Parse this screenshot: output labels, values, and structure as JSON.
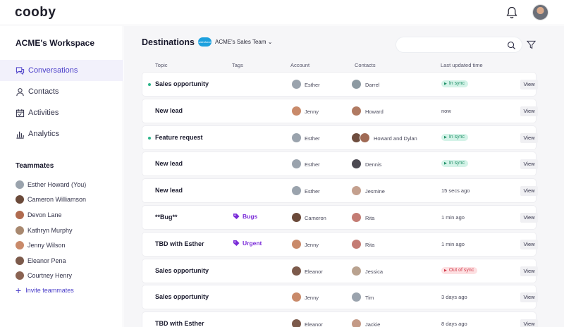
{
  "app": {
    "logo": "cooby"
  },
  "sidebar": {
    "workspace": "ACME's Workspace",
    "nav": [
      {
        "label": "Conversations",
        "icon": "chat-icon",
        "active": true
      },
      {
        "label": "Contacts",
        "icon": "person-icon"
      },
      {
        "label": "Activities",
        "icon": "calendar-icon"
      },
      {
        "label": "Analytics",
        "icon": "bar-chart-icon"
      }
    ],
    "teammates_title": "Teammates",
    "teammates": [
      {
        "name": "Esther Howard (You)",
        "color": "#9aa3ad"
      },
      {
        "name": "Cameron Williamson",
        "color": "#6b4a3a"
      },
      {
        "name": "Devon Lane",
        "color": "#b06b4f"
      },
      {
        "name": "Kathryn Murphy",
        "color": "#a8886f"
      },
      {
        "name": "Jenny Wilson",
        "color": "#c98a6a"
      },
      {
        "name": "Eleanor Pena",
        "color": "#7c5a4b"
      },
      {
        "name": "Courtney Henry",
        "color": "#8a6352"
      }
    ],
    "invite": "Invite teammates"
  },
  "main": {
    "title": "Destinations",
    "salesforce_label": "salesforce",
    "team_select": "ACME's Sales Team",
    "columns": [
      "Topic",
      "Tags",
      "Account",
      "Contacts",
      "Last updated time"
    ],
    "view_label": "View",
    "rows": [
      {
        "topic": "Sales opportunity",
        "dot": true,
        "tag": "",
        "account": "Esther",
        "account_color": "#9aa3ad",
        "contacts": "Darrel",
        "contact_colors": [
          "#8d9aa2"
        ],
        "time": "",
        "status": "In sync"
      },
      {
        "topic": "New lead",
        "dot": false,
        "tag": "",
        "account": "Jenny",
        "account_color": "#c98a6a",
        "contacts": "Howard",
        "contact_colors": [
          "#b07a62"
        ],
        "time": "now",
        "status": ""
      },
      {
        "topic": "Feature request",
        "dot": true,
        "tag": "",
        "account": "Esther",
        "account_color": "#9aa3ad",
        "contacts": "Howard and Dylan",
        "contact_colors": [
          "#6e4d3e",
          "#a06a55"
        ],
        "time": "",
        "status": "In sync"
      },
      {
        "topic": "New lead",
        "dot": false,
        "tag": "",
        "account": "Esther",
        "account_color": "#9aa3ad",
        "contacts": "Dennis",
        "contact_colors": [
          "#4c4a52"
        ],
        "time": "",
        "status": "In sync"
      },
      {
        "topic": "New lead",
        "dot": false,
        "tag": "",
        "account": "Esther",
        "account_color": "#9aa3ad",
        "contacts": "Jesmine",
        "contact_colors": [
          "#c4a08e"
        ],
        "time": "15 secs ago",
        "status": ""
      },
      {
        "topic": "**Bug**",
        "dot": false,
        "tag": "Bugs",
        "account": "Cameron",
        "account_color": "#6b4a3a",
        "contacts": "Rita",
        "contact_colors": [
          "#c47c74"
        ],
        "time": "1 min ago",
        "status": ""
      },
      {
        "topic": "TBD with Esther",
        "dot": false,
        "tag": "Urgent",
        "account": "Jenny",
        "account_color": "#c98a6a",
        "contacts": "Rita",
        "contact_colors": [
          "#c47c74"
        ],
        "time": "1 min ago",
        "status": ""
      },
      {
        "topic": "Sales opportunity",
        "dot": false,
        "tag": "",
        "account": "Eleanor",
        "account_color": "#7c5a4b",
        "contacts": "Jessica",
        "contact_colors": [
          "#b9a28f"
        ],
        "time": "",
        "status": "Out of sync"
      },
      {
        "topic": "Sales opportunity",
        "dot": false,
        "tag": "",
        "account": "Jenny",
        "account_color": "#c98a6a",
        "contacts": "Tim",
        "contact_colors": [
          "#9aa3ad"
        ],
        "time": "3 days ago",
        "status": ""
      },
      {
        "topic": "TBD with Esther",
        "dot": false,
        "tag": "",
        "account": "Eleanor",
        "account_color": "#7c5a4b",
        "contacts": "Jackie",
        "contact_colors": [
          "#c49a86"
        ],
        "time": "8 days ago",
        "status": ""
      }
    ]
  }
}
